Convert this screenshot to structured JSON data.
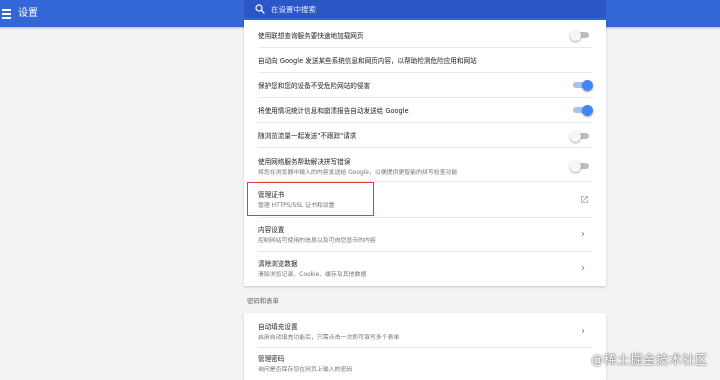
{
  "header": {
    "title": "设置",
    "menu_icon": "hamburger-menu-icon",
    "search_icon": "search-icon",
    "search_placeholder": "在设置中搜索",
    "bar_color": "#3367d6",
    "search_bg_color": "#2a56c6"
  },
  "privacy_rows": [
    {
      "title": "使用联想查询服务要快速地加载网页",
      "toggle": "off"
    },
    {
      "title": "自动向 Google 发送某些系统信息和网页内容，以帮助检测危险应用和网站",
      "toggle": "none"
    },
    {
      "title": "保护您和您的设备不受危险网站的侵害",
      "toggle": "on"
    },
    {
      "title": "将使用情况统计信息和崩溃报告自动发送给 Google",
      "toggle": "on"
    },
    {
      "title": "随浏览流量一起发送\"不跟踪\"请求",
      "toggle": "off"
    },
    {
      "title": "使用网络服务帮助解决拼写错误",
      "subtitle": "将您在浏览器中输入的内容发送给 Google，以便提供更智能的拼写检查功能",
      "toggle": "off"
    }
  ],
  "manage_certificates": {
    "title": "管理证书",
    "subtitle": "管理 HTTPS/SSL 证书和设置",
    "icon": "open-in-new-icon"
  },
  "content_settings": {
    "title": "内容设置",
    "subtitle": "控制网站可使用的信息以及可向您显示的内容"
  },
  "clear_browsing_data": {
    "title": "清除浏览数据",
    "subtitle": "清除浏览记录、Cookie、缓存及其他数据"
  },
  "passwords_section": {
    "heading": "密码和表单",
    "autofill": {
      "title": "自动填充设置",
      "subtitle": "启用自动填充功能后，只需点击一次即可填写多个表单"
    },
    "manage_passwords": {
      "title": "管理密码",
      "subtitle": "询问是否保存您在网页上输入的密码"
    }
  },
  "watermark": "@稀土掘金技术社区",
  "highlight_color": "#e53935",
  "toggle_on_color": "#4285f4"
}
